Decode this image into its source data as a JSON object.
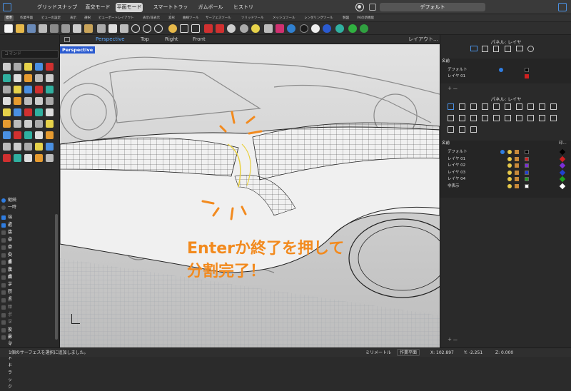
{
  "top_tabs": {
    "grid_snap": "グリッドスナップ",
    "ortho": "直交モード",
    "planar": "平面モード",
    "smart_track": "スマートトラック",
    "gumball": "ガムボール",
    "history": "ヒストリ"
  },
  "top_right": {
    "display_mode": "デフォルト"
  },
  "ribbon": [
    "標準",
    "作業平面",
    "ビューの設定",
    "表示",
    "選択",
    "ビューポートレイアウト",
    "表示/非表示",
    "変形",
    "曲線ツール",
    "サーフェスツール",
    "ソリッドツール",
    "メッシュツール",
    "レンダリングツール",
    "製図",
    "V6の新機能"
  ],
  "command": {
    "placeholder": "コマンド"
  },
  "osnap": [
    "端点",
    "近接点",
    "点",
    "中点",
    "中心点",
    "交点",
    "垂直点",
    "接点",
    "四半円点",
    "ノット",
    "頂点",
    "点線上",
    "サーフェス上",
    "ポリサーフェス上",
    "メッシュ上",
    "投影",
    "スマートトラック"
  ],
  "osnap_top": [
    "継続",
    "一時"
  ],
  "viewport": {
    "tabs": [
      "Perspective",
      "Top",
      "Right",
      "Front"
    ],
    "layout_label": "レイアウト...",
    "label": "Perspective"
  },
  "annotation": {
    "line1": "Enterか終了を押して",
    "line2": "分割完了！"
  },
  "panel1": {
    "title": "パネル: レイヤ",
    "header": "名前",
    "rows": [
      "デフォルト",
      "レイヤ 01"
    ]
  },
  "panel2": {
    "title": "パネル: レイヤ",
    "header": "名前",
    "header2": "印...",
    "rows": [
      "デフォルト",
      "レイヤ 01",
      "レイヤ 02",
      "レイヤ 03",
      "レイヤ 04",
      "非表示"
    ]
  },
  "layer_colors": [
    "#000000",
    "#d02020",
    "#7b2fd6",
    "#2040d0",
    "#20a020",
    "#ffffff"
  ],
  "status": {
    "message": "1個のサーフェスを選択に追加しました。",
    "units": "ミリメートル",
    "cplane": "作業平面",
    "x": "X: 102.897",
    "y": "Y: -2.251",
    "z": "Z: 0.000"
  }
}
